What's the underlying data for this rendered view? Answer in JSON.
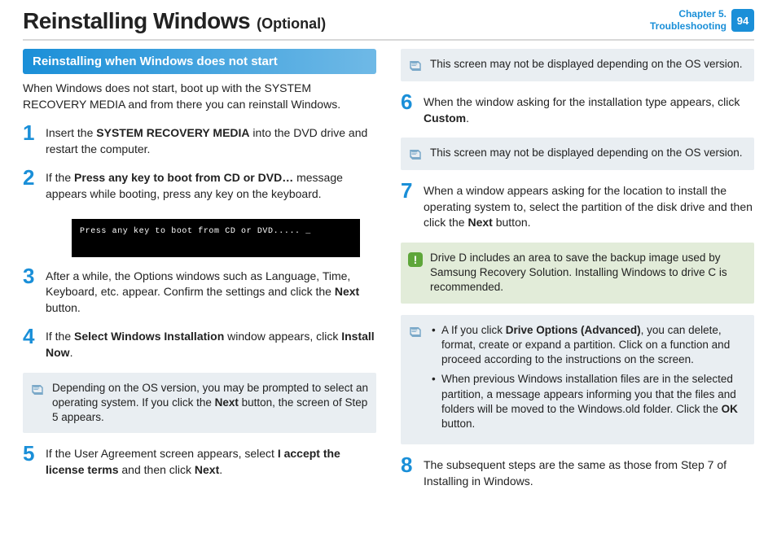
{
  "header": {
    "title": "Reinstalling Windows",
    "subtitle": "(Optional)",
    "chapter_line1": "Chapter 5.",
    "chapter_line2": "Troubleshooting",
    "page_number": "94"
  },
  "left": {
    "heading": "Reinstalling when Windows does not start",
    "intro": "When Windows does not start, boot up with the SYSTEM RECOVERY MEDIA and from there you can reinstall Windows.",
    "step1_pre": "Insert the ",
    "step1_bold": "SYSTEM RECOVERY MEDIA",
    "step1_post": " into the DVD drive and restart the computer.",
    "step2_pre": "If the ",
    "step2_bold": "Press any key to boot from CD or DVD…",
    "step2_post": " message appears while booting, press any key on the keyboard.",
    "screenshot_text": "Press any key to boot from CD or DVD..... _",
    "step3_pre": "After a while, the Options windows such as Language, Time, Keyboard, etc. appear. Confirm the settings and click the ",
    "step3_bold": "Next",
    "step3_post": " button.",
    "step4_pre": "If the ",
    "step4_bold1": "Select Windows Installation",
    "step4_mid": " window appears, click ",
    "step4_bold2": "Install Now",
    "step4_post": ".",
    "note1_pre": "Depending on the OS version, you may be prompted to select an operating system. If you click the ",
    "note1_bold": "Next",
    "note1_post": " button, the screen of Step 5 appears.",
    "step5_pre": "If the User Agreement screen appears, select ",
    "step5_bold1": "I accept the license terms",
    "step5_mid": " and then click ",
    "step5_bold2": "Next",
    "step5_post": "."
  },
  "right": {
    "noteA": "This screen may not be displayed depending on the OS version.",
    "step6_pre": "When the window asking for the installation type appears, click ",
    "step6_bold": "Custom",
    "step6_post": ".",
    "noteB": "This screen may not be displayed depending on the OS version.",
    "step7_pre": "When a window appears asking for the location to install the operating system to, select the partition of the disk drive and then click the ",
    "step7_bold": "Next",
    "step7_post": " button.",
    "warn": "Drive D includes an area to save the backup image used by Samsung Recovery Solution. Installing Windows to drive C is recommended.",
    "noteC_item1_pre": "A If you click ",
    "noteC_item1_bold": "Drive Options (Advanced)",
    "noteC_item1_post": ", you can delete, format, create or expand a partition. Click on a function and proceed according to the instructions on the screen.",
    "noteC_item2_pre": "When previous Windows installation files are in the selected partition, a message appears informing you that the files and folders will be moved to the Windows.old folder. Click the ",
    "noteC_item2_bold": "OK",
    "noteC_item2_post": " button.",
    "step8": "The subsequent steps are the same as those from Step 7 of Installing in Windows."
  },
  "nums": {
    "n1": "1",
    "n2": "2",
    "n3": "3",
    "n4": "4",
    "n5": "5",
    "n6": "6",
    "n7": "7",
    "n8": "8"
  },
  "icons": {
    "warn_glyph": "!"
  }
}
